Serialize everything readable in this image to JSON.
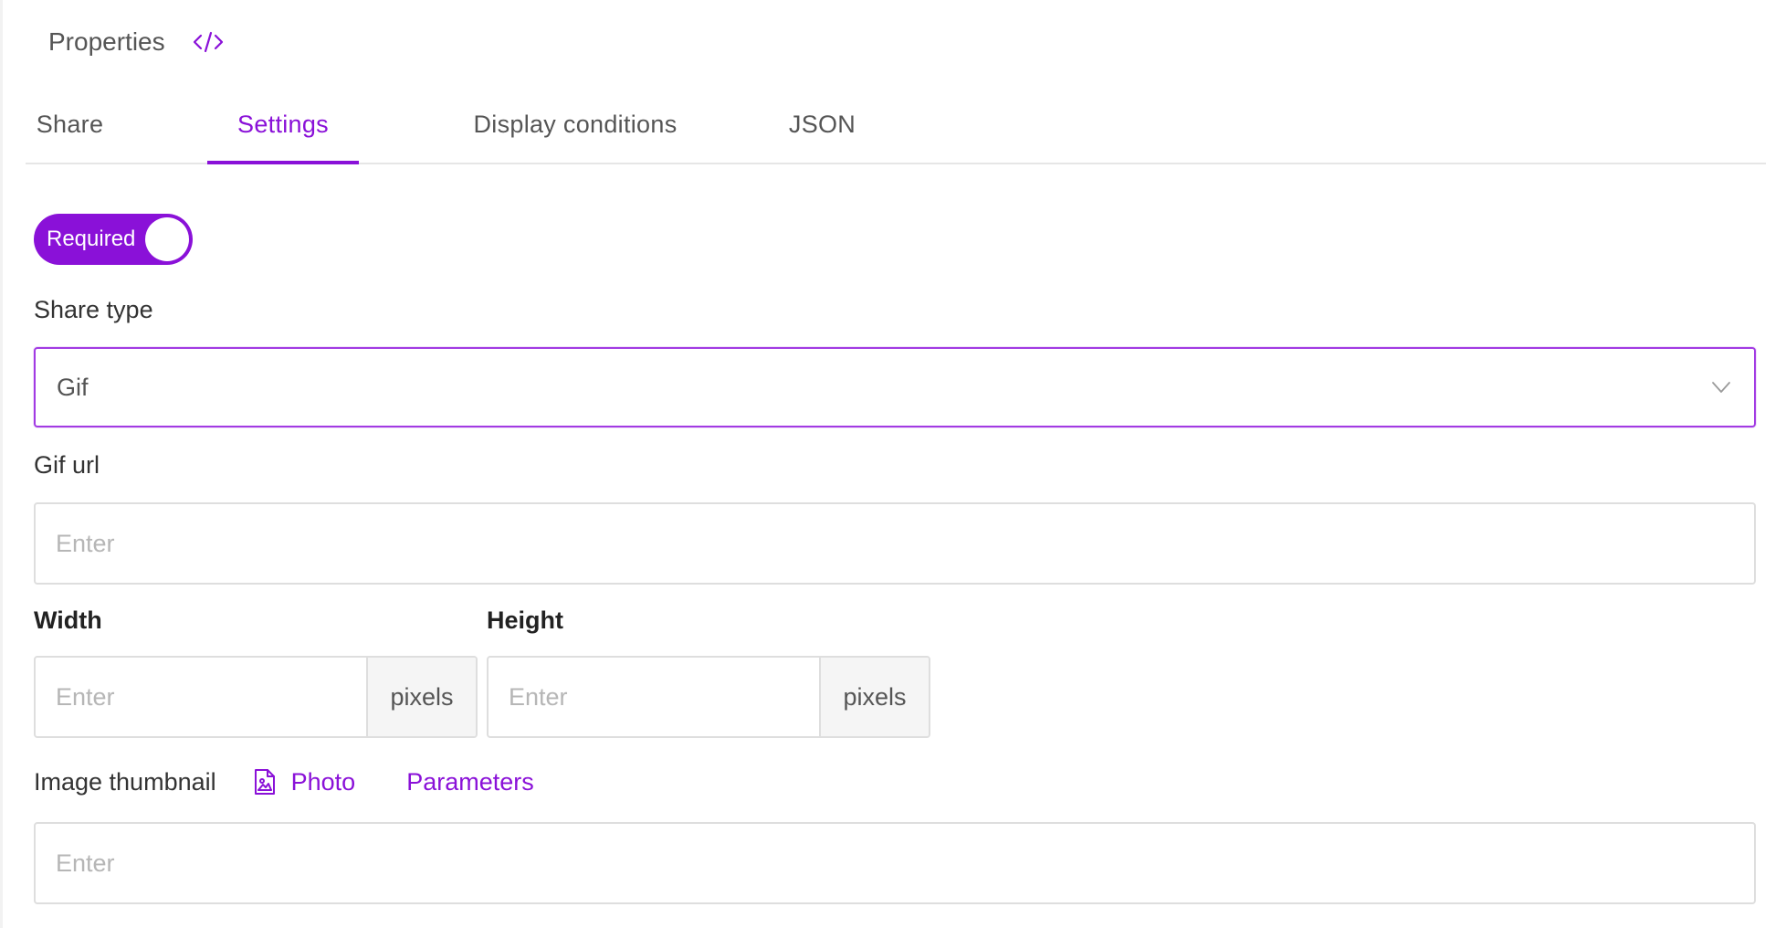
{
  "header": {
    "title": "Properties",
    "code_icon": "code-brackets-icon"
  },
  "tabs": [
    {
      "label": "Share",
      "active": false
    },
    {
      "label": "Settings",
      "active": true
    },
    {
      "label": "Display conditions",
      "active": false
    },
    {
      "label": "JSON",
      "active": false
    }
  ],
  "required_toggle": {
    "label": "Required",
    "on": true
  },
  "share_type": {
    "label": "Share type",
    "value": "Gif",
    "icon": "chevron-down-icon"
  },
  "gif_url": {
    "label": "Gif url",
    "value": "",
    "placeholder": "Enter"
  },
  "width": {
    "label": "Width",
    "value": "",
    "placeholder": "Enter",
    "unit": "pixels"
  },
  "height": {
    "label": "Height",
    "value": "",
    "placeholder": "Enter",
    "unit": "pixels"
  },
  "image_thumbnail": {
    "label": "Image thumbnail",
    "photo_label": "Photo",
    "photo_icon": "image-file-icon",
    "parameters_label": "Parameters",
    "value": "",
    "placeholder": "Enter"
  },
  "colors": {
    "accent": "#8a11d8",
    "border": "#dedede",
    "text": "#333333"
  }
}
